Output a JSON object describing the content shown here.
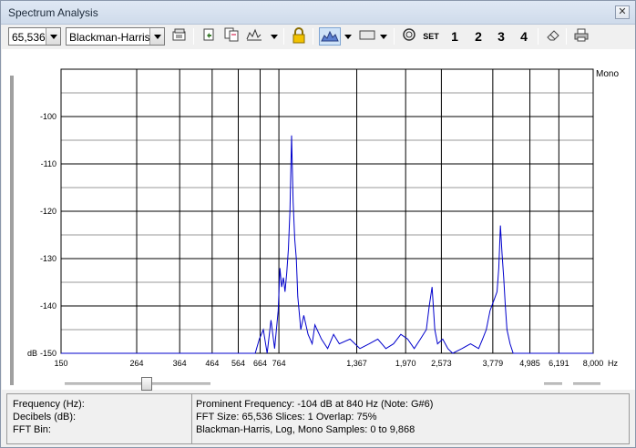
{
  "window": {
    "title": "Spectrum Analysis",
    "close_glyph": "✕"
  },
  "toolbar": {
    "size_value": "65,536",
    "window_value": "Blackman-Harris",
    "set_label": "SET",
    "set1": "1",
    "set2": "2",
    "set3": "3",
    "set4": "4",
    "icons": [
      "properties-icon",
      "export-icon",
      "copy-icon",
      "graph-style-icon",
      "lock-icon",
      "spectrum-view-icon",
      "bar-view-icon",
      "reset-icon",
      "eraser-icon",
      "print-icon"
    ]
  },
  "chart": {
    "channel_label": "Mono",
    "y_unit": "dB",
    "x_unit": "Hz"
  },
  "chart_data": {
    "type": "line",
    "x_scale": "log",
    "xlim": [
      150,
      8000
    ],
    "ylim": [
      -150,
      -90
    ],
    "y_ticks": [
      "-100",
      "-110",
      "-120",
      "-130",
      "-140",
      "-150"
    ],
    "x_ticks": [
      "150",
      "264",
      "364",
      "464",
      "564",
      "664",
      "764",
      "1,367",
      "1,970",
      "2,573",
      "3,779",
      "4,985",
      "6,191",
      "8,000"
    ],
    "grid": true,
    "series": [
      {
        "color": "#0000cc",
        "x": [
          150,
          500,
          640,
          660,
          680,
          700,
          720,
          740,
          760,
          770,
          780,
          790,
          800,
          810,
          820,
          830,
          840,
          850,
          860,
          870,
          880,
          900,
          920,
          950,
          980,
          1000,
          1050,
          1100,
          1150,
          1200,
          1300,
          1400,
          1500,
          1600,
          1700,
          1800,
          1900,
          2000,
          2100,
          2200,
          2300,
          2350,
          2400,
          2450,
          2500,
          2600,
          2700,
          2800,
          3000,
          3200,
          3400,
          3500,
          3600,
          3700,
          3800,
          3900,
          3950,
          4000,
          4050,
          4100,
          4150,
          4200,
          4300,
          4400,
          4600,
          5000,
          8000
        ],
        "y": [
          -150,
          -150,
          -150,
          -147,
          -145,
          -150,
          -143,
          -149,
          -141,
          -132,
          -136,
          -134,
          -137,
          -133,
          -128,
          -120,
          -104,
          -118,
          -126,
          -130,
          -138,
          -145,
          -142,
          -146,
          -148,
          -144,
          -147,
          -149,
          -146,
          -148,
          -147,
          -149,
          -148,
          -147,
          -149,
          -148,
          -146,
          -147,
          -149,
          -147,
          -145,
          -140,
          -136,
          -145,
          -148,
          -147,
          -149,
          -150,
          -149,
          -148,
          -149,
          -147,
          -145,
          -141,
          -139,
          -137,
          -132,
          -123,
          -129,
          -134,
          -140,
          -145,
          -148,
          -150,
          -150,
          -150,
          -150
        ]
      }
    ]
  },
  "status": {
    "frequency_label": "Frequency (Hz):",
    "decibels_label": "Decibels (dB):",
    "fft_bin_label": "FFT Bin:",
    "prominent": "Prominent Frequency: -104 dB at 840 Hz (Note: G#6)",
    "fft_info": "FFT Size: 65,536  Slices: 1  Overlap: 75%",
    "window_info": "Blackman-Harris, Log, Mono  Samples: 0 to 9,868"
  }
}
